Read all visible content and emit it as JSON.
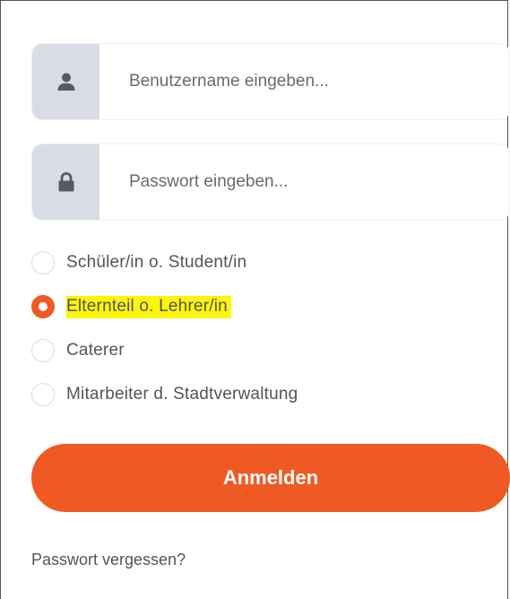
{
  "login": {
    "username": {
      "placeholder": "Benutzername eingeben...",
      "value": "",
      "icon": "user-icon"
    },
    "password": {
      "placeholder": "Passwort eingeben...",
      "value": "",
      "icon": "lock-icon"
    },
    "roles": [
      {
        "label": "Schüler/in o. Student/in",
        "checked": false,
        "highlighted": false
      },
      {
        "label": "Elternteil o. Lehrer/in",
        "checked": true,
        "highlighted": true
      },
      {
        "label": "Caterer",
        "checked": false,
        "highlighted": false
      },
      {
        "label": "Mitarbeiter d. Stadtverwaltung",
        "checked": false,
        "highlighted": false
      }
    ],
    "submit_label": "Anmelden",
    "forgot_label": "Passwort vergessen?"
  },
  "colors": {
    "accent": "#ef5a24",
    "addon_bg": "#d9dce4",
    "highlight": "#fdf50b",
    "text": "#555555"
  }
}
